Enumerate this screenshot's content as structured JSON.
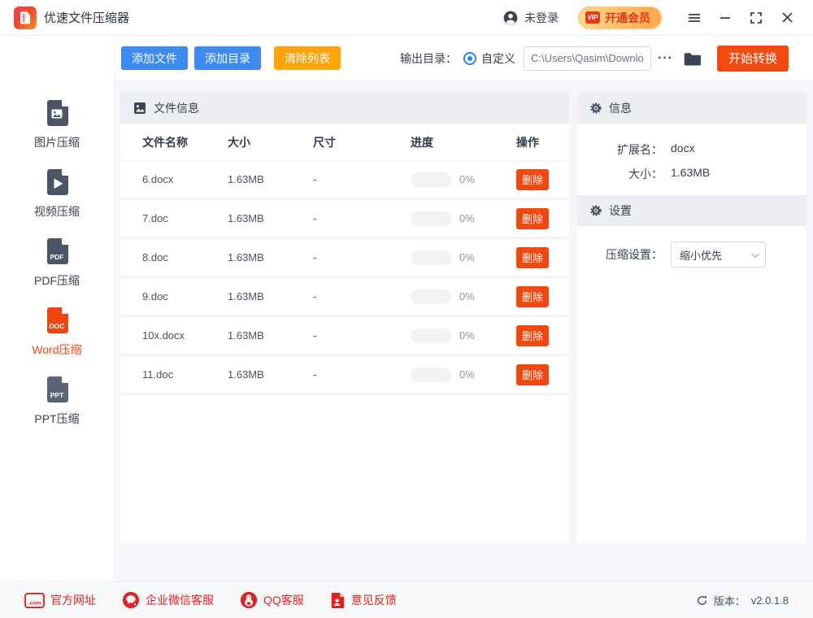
{
  "titlebar": {
    "app_title": "优速文件压缩器",
    "login_status": "未登录",
    "vip_badge": "VIP",
    "vip_button": "开通会员"
  },
  "toolbar": {
    "add_file": "添加文件",
    "add_dir": "添加目录",
    "clear_list": "清除列表",
    "output_dir_label": "输出目录：",
    "radio_custom": "自定义",
    "path_value": "C:\\Users\\Qasim\\Downlo",
    "more_button": "···",
    "start_button": "开始转换"
  },
  "sidebar": {
    "items": [
      {
        "label": "图片压缩",
        "badge": ""
      },
      {
        "label": "视频压缩",
        "badge": ""
      },
      {
        "label": "PDF压缩",
        "badge": "PDF"
      },
      {
        "label": "Word压缩",
        "badge": "DOC",
        "active": true
      },
      {
        "label": "PPT压缩",
        "badge": "PPT"
      }
    ]
  },
  "file_panel": {
    "title": "文件信息",
    "columns": [
      "文件名称",
      "大小",
      "尺寸",
      "进度",
      "操作"
    ],
    "delete_label": "删除",
    "rows": [
      {
        "name": "6.docx",
        "size": "1.63MB",
        "dim": "-",
        "progress": "0%"
      },
      {
        "name": "7.doc",
        "size": "1.63MB",
        "dim": "-",
        "progress": "0%"
      },
      {
        "name": "8.doc",
        "size": "1.63MB",
        "dim": "-",
        "progress": "0%"
      },
      {
        "name": "9.doc",
        "size": "1.63MB",
        "dim": "-",
        "progress": "0%"
      },
      {
        "name": "10x.docx",
        "size": "1.63MB",
        "dim": "-",
        "progress": "0%"
      },
      {
        "name": "11.doc",
        "size": "1.63MB",
        "dim": "-",
        "progress": "0%"
      }
    ]
  },
  "info_panel": {
    "title": "信息",
    "ext_label": "扩展名：",
    "ext_value": "docx",
    "size_label": "大小：",
    "size_value": "1.63MB"
  },
  "settings_panel": {
    "title": "设置",
    "label": "压缩设置：",
    "value": "缩小优先"
  },
  "footer": {
    "site_icon_text": ".com",
    "links": [
      {
        "label": "官方网址"
      },
      {
        "label": "企业微信客服"
      },
      {
        "label": "QQ客服"
      },
      {
        "label": "意见反馈"
      }
    ],
    "version_label": "版本：",
    "version_value": "v2.0.1.8"
  },
  "colors": {
    "accent_blue": "#3D8BF2",
    "accent_orange": "#FFA40B",
    "accent_red": "#F4490F",
    "footer_red": "#DF2222",
    "dark_slate": "#3C4556",
    "panel_header_bg": "#ECEEF2",
    "content_bg": "#F5F6F9"
  }
}
